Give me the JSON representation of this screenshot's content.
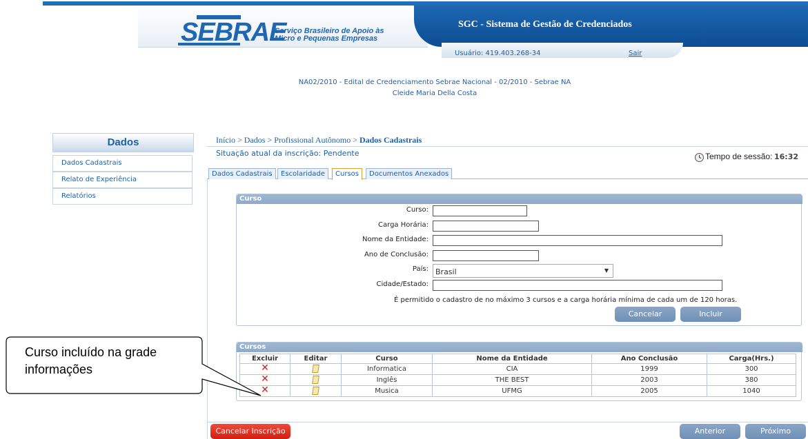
{
  "header": {
    "logo_text": "SEBRAE",
    "logo_subtitle": "Serviço Brasileiro de Apoio às Micro e Pequenas Empresas",
    "app_title": "SGC - Sistema de Gestão de Credenciados",
    "user": "Usuário: 419.403.268-34",
    "logout": "Sair"
  },
  "edital": {
    "line1": "NA02/2010 - Edital de Credenciamento Sebrae Nacional - 02/2010 - Sebrae NA",
    "line2": "Cleide Maria Della Costa"
  },
  "sidebar": {
    "title": "Dados",
    "items": [
      {
        "label": "Dados Cadastrais"
      },
      {
        "label": "Relato de Experiência"
      },
      {
        "label": "Relatórios"
      }
    ]
  },
  "breadcrumb": {
    "path": "Início > Dados > Profissional Autônomo > ",
    "current": "Dados Cadastrais"
  },
  "status": "Situação atual da inscrição: Pendente",
  "session": {
    "label": "Tempo de sessão:",
    "time": "16:32",
    "icon": "clock-icon"
  },
  "tabs": [
    {
      "label": "Dados Cadastrais",
      "active": false
    },
    {
      "label": "Escolaridade",
      "active": false
    },
    {
      "label": "Cursos",
      "active": true
    },
    {
      "label": "Documentos Anexados",
      "active": false
    }
  ],
  "curso_form": {
    "title": "Curso",
    "fields": {
      "curso": {
        "label": "Curso:",
        "value": ""
      },
      "carga": {
        "label": "Carga Horária:",
        "value": ""
      },
      "entidade": {
        "label": "Nome da Entidade:",
        "value": ""
      },
      "ano": {
        "label": "Ano de Conclusão:",
        "value": ""
      },
      "pais": {
        "label": "País:",
        "value": "Brasil"
      },
      "cidade": {
        "label": "Cidade/Estado:",
        "value": ""
      }
    },
    "note": "É permitido o cadastro de no máximo 3 cursos e a carga horária mínima de cada um de 120 horas.",
    "cancel_label": "Cancelar",
    "include_label": "Incluir"
  },
  "grid": {
    "title": "Cursos",
    "columns": [
      "Excluir",
      "Editar",
      "Curso",
      "Nome da Entidade",
      "Ano Conclusão",
      "Carga(Hrs.)"
    ],
    "rows": [
      {
        "curso": "Informatica",
        "entidade": "CIA",
        "ano": "1999",
        "carga": "300"
      },
      {
        "curso": "Inglês",
        "entidade": "THE BEST",
        "ano": "2003",
        "carga": "380"
      },
      {
        "curso": "Musica",
        "entidade": "UFMG",
        "ano": "2005",
        "carga": "1040"
      }
    ]
  },
  "callout": {
    "text": "Curso incluído na grade informações"
  },
  "footer": {
    "cancel_inscricao": "Cancelar Inscrição",
    "prev": "Anterior",
    "next": "Próximo"
  },
  "colors": {
    "brand_blue": "#1f67b1",
    "danger": "#d31f12",
    "button": "#7d99bd"
  }
}
